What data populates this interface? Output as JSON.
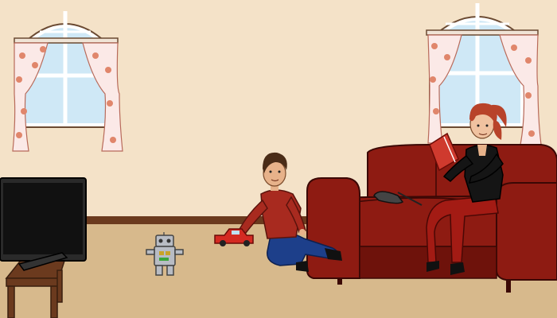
{
  "scene": {
    "colors": {
      "wall": "#f4e2c8",
      "floor": "#d7b98c",
      "baseboard": "#6b3a1e",
      "sofa": "#8e1b12",
      "sofa_shadow": "#6e120b",
      "curtain": "#fbe9e7",
      "curtain_flower": "#e0866b",
      "sky": "#cfe8f6",
      "tv_screen": "#111111",
      "table": "#6b3a1e",
      "boy_shirt": "#a82a1f",
      "boy_jeans": "#1d3f8a",
      "woman_jacket": "#151515",
      "woman_pants": "#a31b14",
      "woman_hair": "#b8432a",
      "book": "#cf3a2e",
      "toy_car": "#d42a22",
      "robot": "#b8bcc4"
    },
    "objects": [
      "window-left",
      "window-right",
      "television",
      "tv-table",
      "toy-robot",
      "boy",
      "toy-car",
      "sofa",
      "woman-reading",
      "book",
      "tv-remote"
    ]
  }
}
